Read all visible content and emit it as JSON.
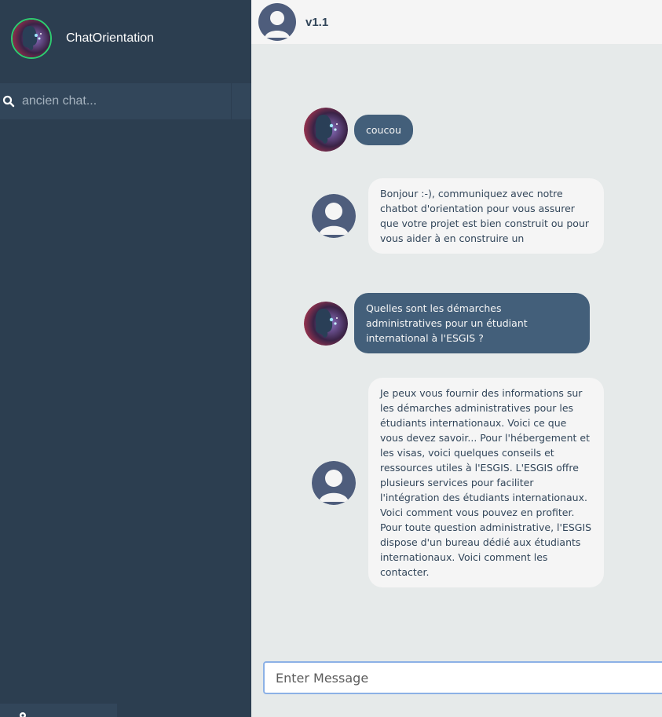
{
  "sidebar": {
    "brand_name": "ChatOrientation",
    "search_placeholder": "ancien chat...",
    "bottom_tab_label": "..."
  },
  "header": {
    "title": "v1.1"
  },
  "messages": [
    {
      "role": "sent",
      "text": "coucou"
    },
    {
      "role": "replied",
      "text": "Bonjour :-), communiquez avec notre chatbot d'orientation pour vous assurer que votre projet est bien construit ou pour vous aider à en construire un"
    },
    {
      "role": "sent",
      "text": "Quelles sont les démarches administratives pour un étudiant international à l'ESGIS ?"
    },
    {
      "role": "replied",
      "text": "Je peux vous fournir des informations sur les démarches administratives pour les étudiants internationaux. Voici ce que vous devez savoir... Pour l'hébergement et les visas, voici quelques conseils et ressources utiles à l'ESGIS. L'ESGIS offre plusieurs services pour faciliter l'intégration des étudiants internationaux. Voici comment vous pouvez en profiter. Pour toute question administrative, l'ESGIS dispose d'un bureau dédié aux étudiants internationaux. Voici comment les contacter."
    }
  ],
  "composer": {
    "placeholder": "Enter Message"
  },
  "colors": {
    "sidebar_bg": "#2c3e50",
    "search_bg": "#32465a",
    "sent_bubble": "#435f7a",
    "replied_bubble": "#f5f5f5",
    "chat_bg": "#e6eaea",
    "brand_ring": "#2ecc71"
  },
  "icons": [
    "search-icon",
    "gear-icon",
    "ai-avatar",
    "user-avatar"
  ]
}
